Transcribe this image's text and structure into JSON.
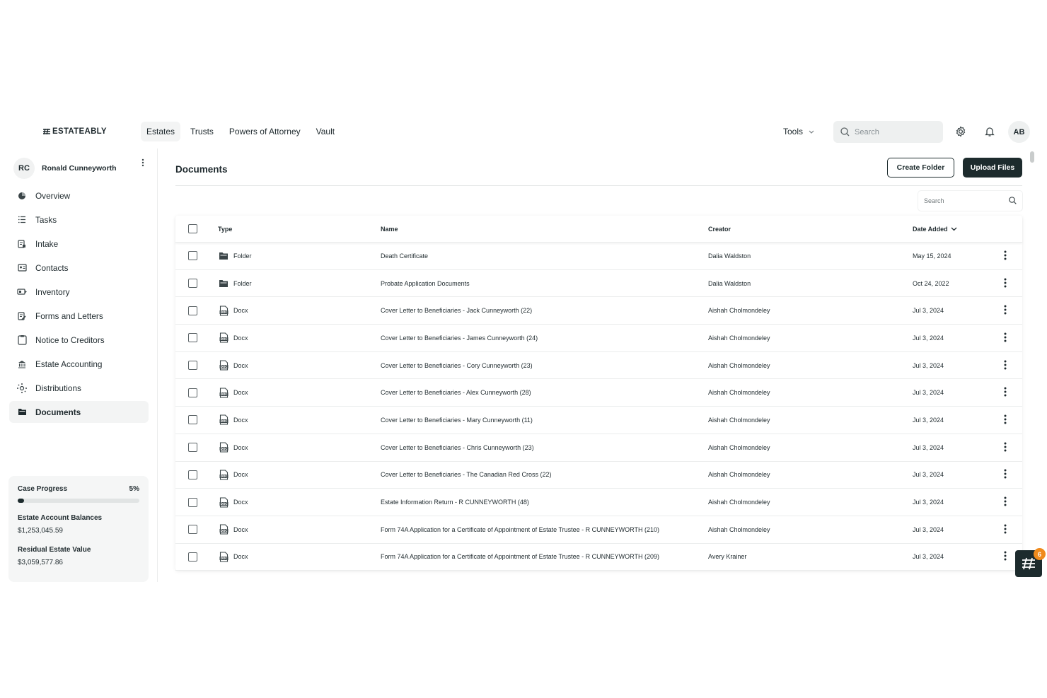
{
  "brand": "ESTATEABLY",
  "nav": [
    "Estates",
    "Trusts",
    "Powers of Attorney",
    "Vault"
  ],
  "tools_label": "Tools",
  "top_search_placeholder": "Search",
  "user_initials": "AB",
  "estate": {
    "initials": "RC",
    "name": "Ronald Cunneyworth"
  },
  "sidebar": [
    {
      "label": "Overview",
      "icon": "pie-icon"
    },
    {
      "label": "Tasks",
      "icon": "list-icon"
    },
    {
      "label": "Intake",
      "icon": "intake-icon"
    },
    {
      "label": "Contacts",
      "icon": "contacts-icon"
    },
    {
      "label": "Inventory",
      "icon": "inventory-icon"
    },
    {
      "label": "Forms and Letters",
      "icon": "forms-icon"
    },
    {
      "label": "Notice to Creditors",
      "icon": "clipboard-icon"
    },
    {
      "label": "Estate Accounting",
      "icon": "bank-icon"
    },
    {
      "label": "Distributions",
      "icon": "distributions-icon"
    },
    {
      "label": "Documents",
      "icon": "folder-icon",
      "active": true
    }
  ],
  "progress": {
    "label": "Case Progress",
    "percent_text": "5%",
    "percent": 5,
    "balances_label": "Estate Account Balances",
    "balances_value": "$1,253,045.59",
    "residual_label": "Residual Estate Value",
    "residual_value": "$3,059,577.86"
  },
  "page_title": "Documents",
  "create_folder": "Create Folder",
  "upload_files": "Upload Files",
  "table_search_placeholder": "Search",
  "columns": {
    "type": "Type",
    "name": "Name",
    "creator": "Creator",
    "date": "Date Added"
  },
  "rows": [
    {
      "type": "Folder",
      "name": "Death Certificate",
      "creator": "Dalia Waldston",
      "date": "May 15, 2024"
    },
    {
      "type": "Folder",
      "name": "Probate Application Documents",
      "creator": "Dalia Waldston",
      "date": "Oct 24, 2022"
    },
    {
      "type": "Docx",
      "name": "Cover Letter to Beneficiaries - Jack Cunneyworth (22)",
      "creator": "Aishah Cholmondeley",
      "date": "Jul 3, 2024"
    },
    {
      "type": "Docx",
      "name": "Cover Letter to Beneficiaries - James Cunneyworth (24)",
      "creator": "Aishah Cholmondeley",
      "date": "Jul 3, 2024"
    },
    {
      "type": "Docx",
      "name": "Cover Letter to Beneficiaries - Cory Cunneyworth (23)",
      "creator": "Aishah Cholmondeley",
      "date": "Jul 3, 2024"
    },
    {
      "type": "Docx",
      "name": "Cover Letter to Beneficiaries - Alex Cunneyworth (28)",
      "creator": "Aishah Cholmondeley",
      "date": "Jul 3, 2024"
    },
    {
      "type": "Docx",
      "name": "Cover Letter to Beneficiaries - Mary Cunneyworth (11)",
      "creator": "Aishah Cholmondeley",
      "date": "Jul 3, 2024"
    },
    {
      "type": "Docx",
      "name": "Cover Letter to Beneficiaries - Chris Cunneyworth (23)",
      "creator": "Aishah Cholmondeley",
      "date": "Jul 3, 2024"
    },
    {
      "type": "Docx",
      "name": "Cover Letter to Beneficiaries - The Canadian Red Cross (22)",
      "creator": "Aishah Cholmondeley",
      "date": "Jul 3, 2024"
    },
    {
      "type": "Docx",
      "name": "Estate Information Return - R CUNNEYWORTH (48)",
      "creator": "Aishah Cholmondeley",
      "date": "Jul 3, 2024"
    },
    {
      "type": "Docx",
      "name": "Form 74A Application for a Certificate of Appointment of Estate Trustee - R CUNNEYWORTH (210)",
      "creator": "Aishah Cholmondeley",
      "date": "Jul 3, 2024"
    },
    {
      "type": "Docx",
      "name": "Form 74A Application for a Certificate of Appointment of Estate Trustee - R CUNNEYWORTH (209)",
      "creator": "Avery Krainer",
      "date": "Jul 3, 2024"
    }
  ],
  "chat_badge": "6",
  "colors": {
    "primary": "#1d2b2d",
    "badge": "#f08a1c"
  }
}
